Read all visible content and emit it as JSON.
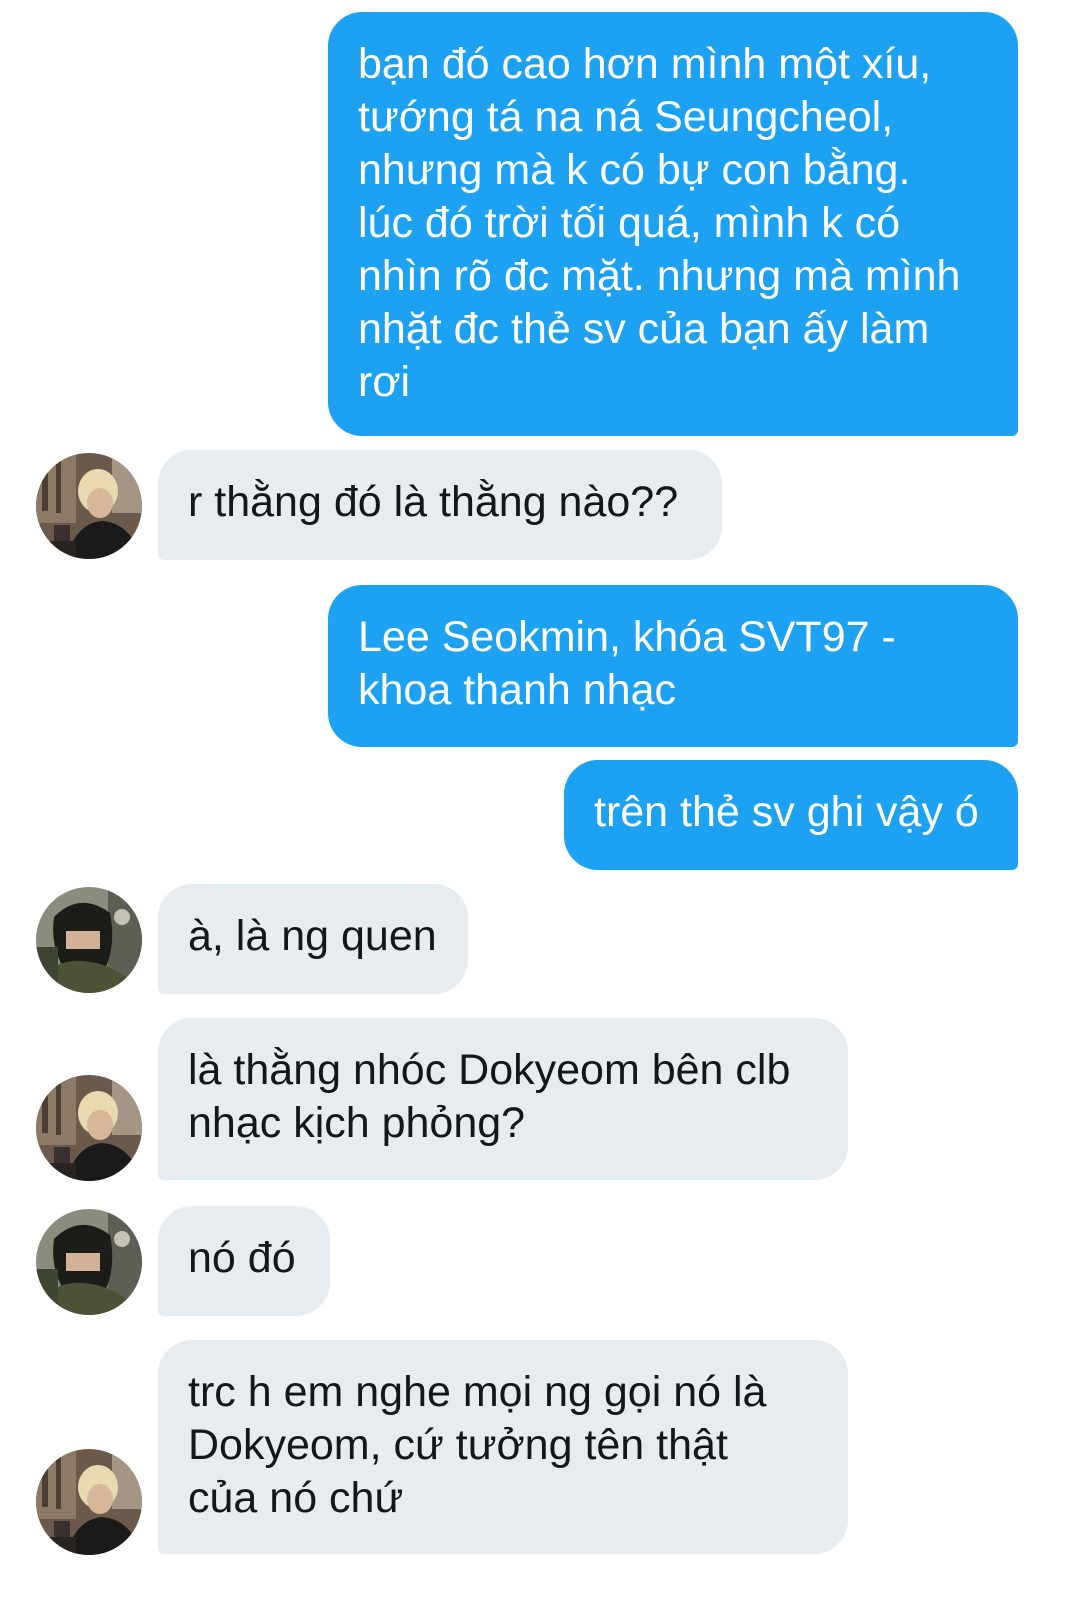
{
  "conversation": {
    "messages": [
      {
        "direction": "sent",
        "text": "bạn đó cao hơn mình một xíu,\ntướng tá na ná Seungcheol,\nnhưng mà k có bự con bằng.\nlúc đó trời tối quá, mình k có\nnhìn rõ đc mặt. nhưng mà mình\nnhặt đc thẻ sv của bạn ấy làm\nrơi"
      },
      {
        "direction": "received",
        "text": "r thằng đó là thằng nào??",
        "avatar": "blonde-user-avatar"
      },
      {
        "direction": "sent",
        "text": "Lee Seokmin, khóa SVT97 -\nkhoa thanh nhạc"
      },
      {
        "direction": "sent",
        "text": "trên thẻ sv ghi vậy ó"
      },
      {
        "direction": "received",
        "text": "à, là ng quen",
        "avatar": "dark-hair-user-avatar"
      },
      {
        "direction": "received",
        "text": "là thằng nhóc Dokyeom bên clb\nnhạc kịch phỏng?",
        "avatar": "blonde-user-avatar"
      },
      {
        "direction": "received",
        "text": "nó đó",
        "avatar": "dark-hair-user-avatar"
      },
      {
        "direction": "received",
        "text": "trc h em nghe mọi ng gọi nó là\nDokyeom, cứ tưởng tên thật\ncủa nó chứ",
        "avatar": "blonde-user-avatar"
      }
    ]
  },
  "colors": {
    "sent_bubble": "#1da1f2",
    "received_bubble": "#e6ecf0",
    "sent_text": "#ffffff",
    "received_text": "#14171a"
  }
}
